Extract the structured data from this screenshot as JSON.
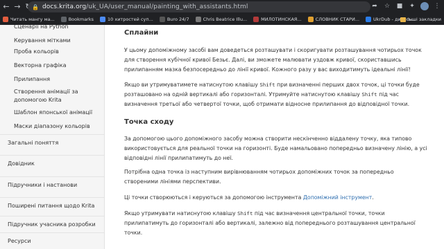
{
  "browser": {
    "url_domain": "docs.krita.org",
    "url_path": "/uk_UA/user_manual/painting_with_assistants.html",
    "bookmarks": [
      {
        "label": "Читать мангу ма...",
        "color": "#e35d3f"
      },
      {
        "label": "Bookmarks",
        "color": "#5f6368"
      },
      {
        "label": "10 хитростей суп...",
        "color": "#4c8bf5"
      },
      {
        "label": "Buro 24/7",
        "color": "#555555"
      },
      {
        "label": "Chris Beatrice Illu...",
        "color": "#7a7a7a"
      },
      {
        "label": "МИЛОТИНСКАЯ...",
        "color": "#b33a3a"
      },
      {
        "label": "СЛОВНИК СТАРИ...",
        "color": "#e0a030"
      },
      {
        "label": "UkrDub - дивись...",
        "color": "#2b7de9"
      }
    ],
    "other_bookmarks": "Інші закладки"
  },
  "sidebar": {
    "sub_items": [
      "Сценарії на Python",
      "Керування мітками",
      "Проба кольорів",
      "Векторна графіка",
      "Прилипання",
      "Створення анімації за допомогою Krita",
      "Шаблон японської анімації",
      "Маски діапазону кольорів"
    ],
    "top_items": [
      "Загальні поняття",
      "Довідник",
      "Підручники і настанови",
      "Поширені питання щодо Krita",
      "Підручник учасника розробки",
      "Ресурси"
    ]
  },
  "content": {
    "h1": "Сплайни",
    "p1": "У цьому допоміжному засобі вам доведеться розташувати і скоригувати розташування чотирьох точок для створення кубічної кривої Безьє. Далі, ви зможете малювати уздовж кривої, скориставшись прилипанням мазка безпосередньо до лінії кривої. Кожного разу у вас виходитимуть ідеальні лінії!",
    "p2a": "Якщо ви утримуватимете натиснутою клавішу ",
    "p2_key": "Shift",
    "p2b": " при визначенні перших двох точок, ці точки буде розташовано на одній вертикалі або горизонталі. Утримуйте натиснутою клавішу ",
    "p2_key2": "Shift",
    "p2c": " під час визначення третьої або четвертої точки, щоб отримати відносне прилипання до відповідної точки.",
    "h2": "Точка сходу",
    "p3": "За допомогою цього допоміжного засобу можна створити нескінченно віддалену точку, яка типово використовується для реальної точки на горизонті. Буде намальовано попередньо визначену лінію, а усі відповідні лінії прилипатимуть до неї.",
    "p4": "Потрібна одна точка із наступним вирівнюванням чотирьох допоміжних точок за попередньо створеними лініями перспективи.",
    "p5a": "Ці точки створюються і керуються за допомогою інструмента ",
    "p5_link": "Допоміжний інструмент",
    "p5b": ".",
    "p6a": "Якщо утримувати натиснутою клавішу ",
    "p6_key": "Shift",
    "p6b": " під час визначення центральної точки, точки прилипатимуть до горизонталі або вертикалі, залежно від попереднього розташування центральної точки."
  }
}
